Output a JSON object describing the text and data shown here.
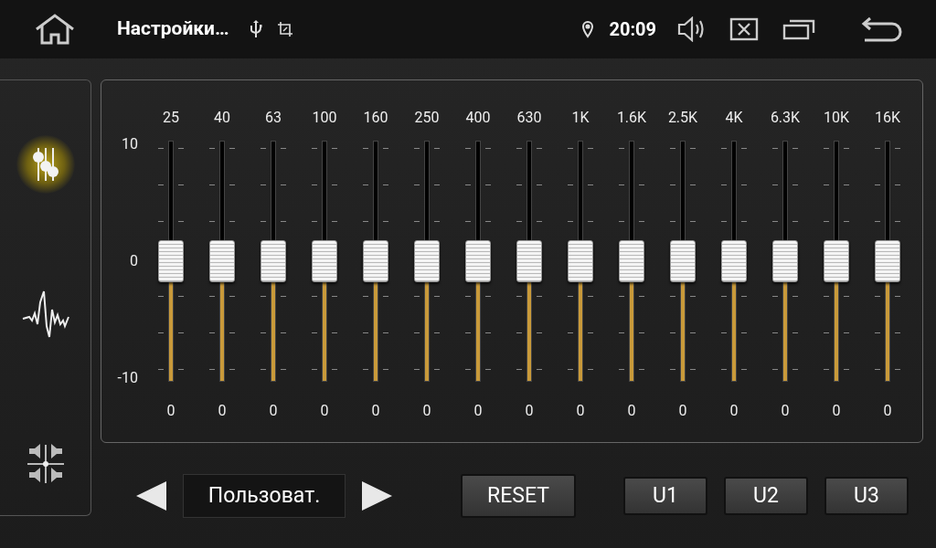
{
  "status_bar": {
    "title": "Настройки…",
    "time": "20:09"
  },
  "sidebar": {
    "items": [
      {
        "kind": "equalizer",
        "selected": true
      },
      {
        "kind": "waveform",
        "selected": false
      },
      {
        "kind": "speakers",
        "selected": false
      }
    ]
  },
  "equalizer": {
    "scale": [
      "10",
      "0",
      "-10"
    ],
    "bands": [
      {
        "label": "25",
        "level": 0.5,
        "value": "0"
      },
      {
        "label": "40",
        "level": 0.5,
        "value": "0"
      },
      {
        "label": "63",
        "level": 0.5,
        "value": "0"
      },
      {
        "label": "100",
        "level": 0.5,
        "value": "0"
      },
      {
        "label": "160",
        "level": 0.5,
        "value": "0"
      },
      {
        "label": "250",
        "level": 0.5,
        "value": "0"
      },
      {
        "label": "400",
        "level": 0.5,
        "value": "0"
      },
      {
        "label": "630",
        "level": 0.5,
        "value": "0"
      },
      {
        "label": "1K",
        "level": 0.5,
        "value": "0"
      },
      {
        "label": "1.6K",
        "level": 0.5,
        "value": "0"
      },
      {
        "label": "2.5K",
        "level": 0.5,
        "value": "0"
      },
      {
        "label": "4K",
        "level": 0.5,
        "value": "0"
      },
      {
        "label": "6.3K",
        "level": 0.5,
        "value": "0"
      },
      {
        "label": "10K",
        "level": 0.5,
        "value": "0"
      },
      {
        "label": "16K",
        "level": 0.5,
        "value": "0"
      }
    ]
  },
  "preset": {
    "value": "Пользоват."
  },
  "buttons": [
    "RESET"
  ],
  "user_presets": [
    "U1",
    "U2",
    "U3"
  ]
}
